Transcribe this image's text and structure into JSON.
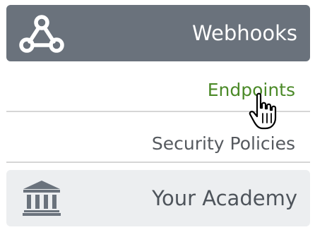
{
  "header": {
    "title": "Webhooks",
    "icon": "webhook-icon"
  },
  "items": [
    {
      "label": "Endpoints",
      "state": "hover",
      "color": "#4b8a28"
    },
    {
      "label": "Security Policies"
    }
  ],
  "academy": {
    "title": "Your Academy",
    "icon": "bank-icon"
  },
  "cursor": "hand-pointer-cursor",
  "colors": {
    "header_bg": "#6a727c",
    "academy_bg": "#eceef0",
    "divider": "#d6d6d6"
  }
}
